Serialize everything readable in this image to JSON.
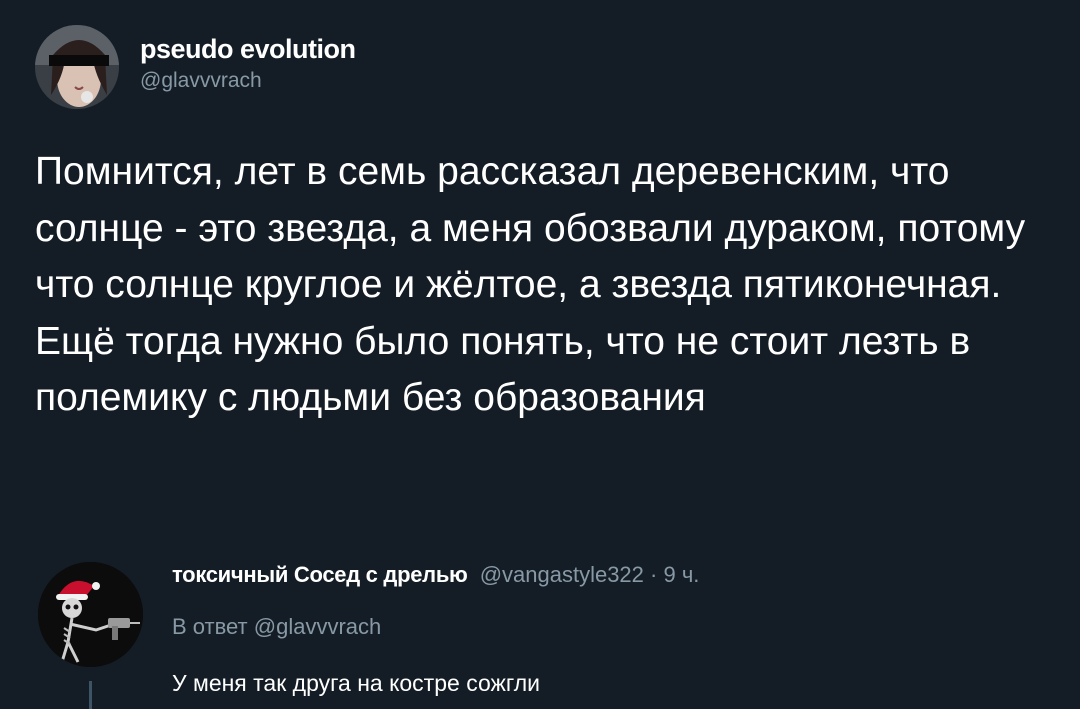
{
  "tweet": {
    "author": {
      "display_name": "pseudo evolution",
      "handle": "@glavvvrach"
    },
    "text": "Помнится, лет в семь рассказал деревенским, что солнце - это звезда, а меня обозвали дураком, потому что солнце круглое и жёлтое, а звезда пятиконечная. Ещё тогда нужно было понять, что не стоит лезть в полемику с людьми без образования"
  },
  "reply": {
    "author": {
      "display_name": "токсичный Сосед с дрелью",
      "handle": "@vangastyle322",
      "separator": " · ",
      "time": "9 ч."
    },
    "reply_to_prefix": "В ответ ",
    "reply_to_handle": "@glavvvrach",
    "text": "У меня так друга на костре сожгли"
  },
  "colors": {
    "background": "#141d26",
    "text": "#ffffff",
    "secondary": "#8899a6",
    "thread_line": "#3d5466"
  }
}
